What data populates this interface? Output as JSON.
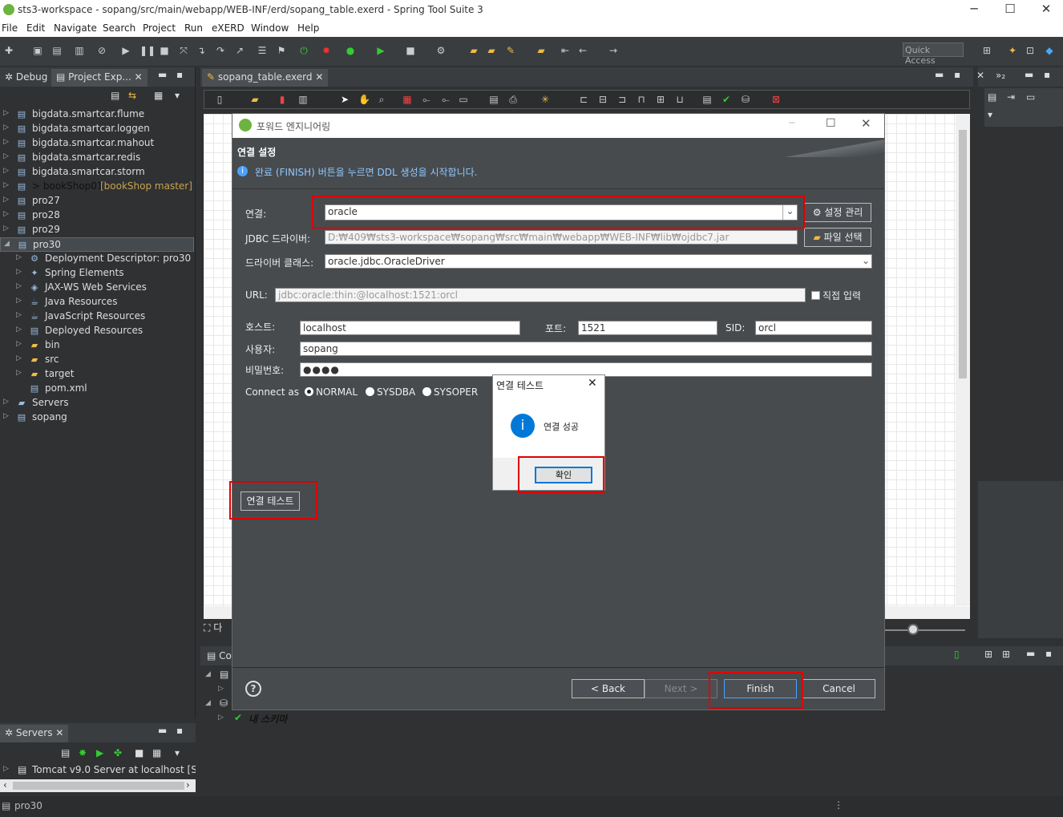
{
  "window": {
    "title": "sts3-workspace - sopang/src/main/webapp/WEB-INF/erd/sopang_table.exerd - Spring Tool Suite 3"
  },
  "menu": [
    "File",
    "Edit",
    "Navigate",
    "Search",
    "Project",
    "Run",
    "eXERD",
    "Window",
    "Help"
  ],
  "toolbar": {
    "quick_access": "Quick Access"
  },
  "left_panel": {
    "tabs": [
      "Debug",
      "Project Exp..."
    ],
    "tree": [
      {
        "label": "bigdata.smartcar.flume",
        "indent": 0
      },
      {
        "label": "bigdata.smartcar.loggen",
        "indent": 0
      },
      {
        "label": "bigdata.smartcar.mahout",
        "indent": 0
      },
      {
        "label": "bigdata.smartcar.redis",
        "indent": 0
      },
      {
        "label": "bigdata.smartcar.storm",
        "indent": 0
      },
      {
        "label": "> bookShop01",
        "suffix": "[bookShop master]",
        "indent": 0
      },
      {
        "label": "pro27",
        "indent": 0
      },
      {
        "label": "pro28",
        "indent": 0
      },
      {
        "label": "pro29",
        "indent": 0
      },
      {
        "label": "pro30",
        "indent": 0,
        "expanded": true,
        "selected": true
      },
      {
        "label": "Deployment Descriptor: pro30",
        "indent": 1
      },
      {
        "label": "Spring Elements",
        "indent": 1
      },
      {
        "label": "JAX-WS Web Services",
        "indent": 1
      },
      {
        "label": "Java Resources",
        "indent": 1
      },
      {
        "label": "JavaScript Resources",
        "indent": 1
      },
      {
        "label": "Deployed Resources",
        "indent": 1
      },
      {
        "label": "bin",
        "indent": 1
      },
      {
        "label": "src",
        "indent": 1
      },
      {
        "label": "target",
        "indent": 1
      },
      {
        "label": "pom.xml",
        "indent": 1,
        "leaf": true
      },
      {
        "label": "Servers",
        "indent": 0
      },
      {
        "label": "sopang",
        "indent": 0
      }
    ]
  },
  "servers_panel": {
    "tab": "Servers",
    "item": "Tomcat v9.0 Server at localhost  [Sto"
  },
  "editor": {
    "tab": "sopang_table.exerd",
    "bottom_label": "다",
    "console_tab": "Co",
    "console_item": "내 스키마"
  },
  "status_bar": {
    "text": "pro30"
  },
  "dialog": {
    "title": "포워드 엔지니어링",
    "section_title": "연결 설정",
    "info": "완료 (FINISH) 버튼을 누르면 DDL 생성을 시작합니다.",
    "connection_label": "연결:",
    "connection_value": "oracle",
    "manage_button": "설정 관리",
    "jdbc_label": "JDBC 드라이버:",
    "jdbc_value": "D:₩409₩sts3-workspace₩sopang₩src₩main₩webapp₩WEB-INF₩lib₩ojdbc7.jar",
    "file_button": "파일 선택",
    "driver_label": "드라이버 클래스:",
    "driver_value": "oracle.jdbc.OracleDriver",
    "url_label": "URL:",
    "url_value": "jdbc:oracle:thin:@localhost:1521:orcl",
    "direct_input": "직접 입력",
    "host_label": "호스트:",
    "host_value": "localhost",
    "port_label": "포트:",
    "port_value": "1521",
    "sid_label": "SID:",
    "sid_value": "orcl",
    "user_label": "사용자:",
    "user_value": "sopang",
    "password_label": "비밀번호:",
    "password_value": "●●●●",
    "connect_as_label": "Connect as",
    "connect_as_options": [
      "NORMAL",
      "SYSDBA",
      "SYSOPER"
    ],
    "connect_as_selected": "NORMAL",
    "test_button": "연결 테스트",
    "back_button": "< Back",
    "next_button": "Next >",
    "finish_button": "Finish",
    "cancel_button": "Cancel"
  },
  "message_box": {
    "title": "연결 테스트",
    "message": "연결 성공",
    "ok_button": "확인"
  },
  "colors": {
    "highlight": "#e00000",
    "accent": "#0078d7"
  }
}
